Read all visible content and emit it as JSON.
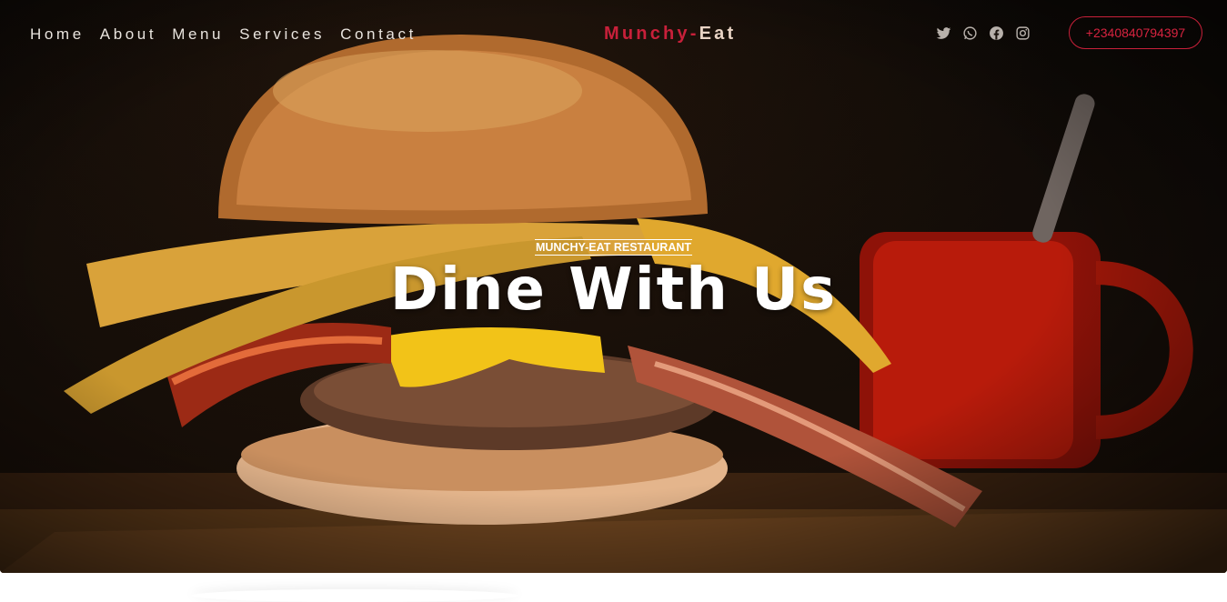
{
  "nav": {
    "items": [
      "Home",
      "About",
      "Menu",
      "Services",
      "Contact"
    ]
  },
  "brand": {
    "part1": "Munchy-",
    "part2": "Eat"
  },
  "social": {
    "icons": [
      "twitter-icon",
      "whatsapp-icon",
      "facebook-icon",
      "instagram-icon"
    ]
  },
  "phone": {
    "label": "+2340840794397"
  },
  "hero": {
    "kicker": "MUNCHY-EAT RESTAURANT",
    "headline": "Dine With Us"
  },
  "colors": {
    "accent": "#c8203a",
    "text_light": "#e9e4de"
  }
}
